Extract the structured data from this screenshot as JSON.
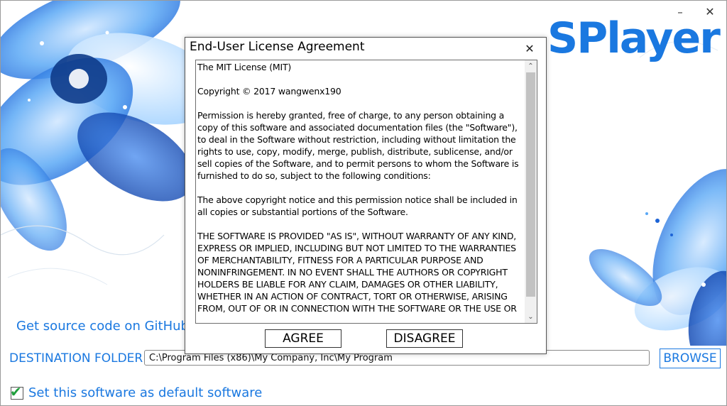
{
  "app": {
    "name": "SPlayer",
    "window_buttons": {
      "minimize": "–",
      "close": "✕"
    },
    "brand_color": "#1a78e0"
  },
  "github_link": "Get source code on GitHub",
  "destination": {
    "label": "DESTINATION FOLDER",
    "value": "C:\\Program Files (x86)\\My Company, Inc\\My Program",
    "browse_label": "BROWSE"
  },
  "default_software": {
    "checked": true,
    "label": "Set this software as default software"
  },
  "eula": {
    "title": "End-User License Agreement",
    "close_glyph": "✕",
    "text": "The MIT License (MIT)\n\nCopyright © 2017 wangwenx190\n\nPermission is hereby granted, free of charge, to any person obtaining a copy of this software and associated documentation files (the \"Software\"), to deal in the Software without restriction, including without limitation the rights to use, copy, modify, merge, publish, distribute, sublicense, and/or sell copies of the Software, and to permit persons to whom the Software is furnished to do so, subject to the following conditions:\n\nThe above copyright notice and this permission notice shall be included in all copies or substantial portions of the Software.\n\nTHE SOFTWARE IS PROVIDED \"AS IS\", WITHOUT WARRANTY OF ANY KIND, EXPRESS OR IMPLIED, INCLUDING BUT NOT LIMITED TO THE WARRANTIES OF MERCHANTABILITY, FITNESS FOR A PARTICULAR PURPOSE AND NONINFRINGEMENT. IN NO EVENT SHALL THE AUTHORS OR COPYRIGHT HOLDERS BE LIABLE FOR ANY CLAIM, DAMAGES OR OTHER LIABILITY, WHETHER IN AN ACTION OF CONTRACT, TORT OR OTHERWISE, ARISING FROM, OUT OF OR IN CONNECTION WITH THE SOFTWARE OR THE USE OR",
    "scroll_up": "⌃",
    "scroll_down": "⌄",
    "agree_label": "AGREE",
    "disagree_label": "DISAGREE"
  }
}
